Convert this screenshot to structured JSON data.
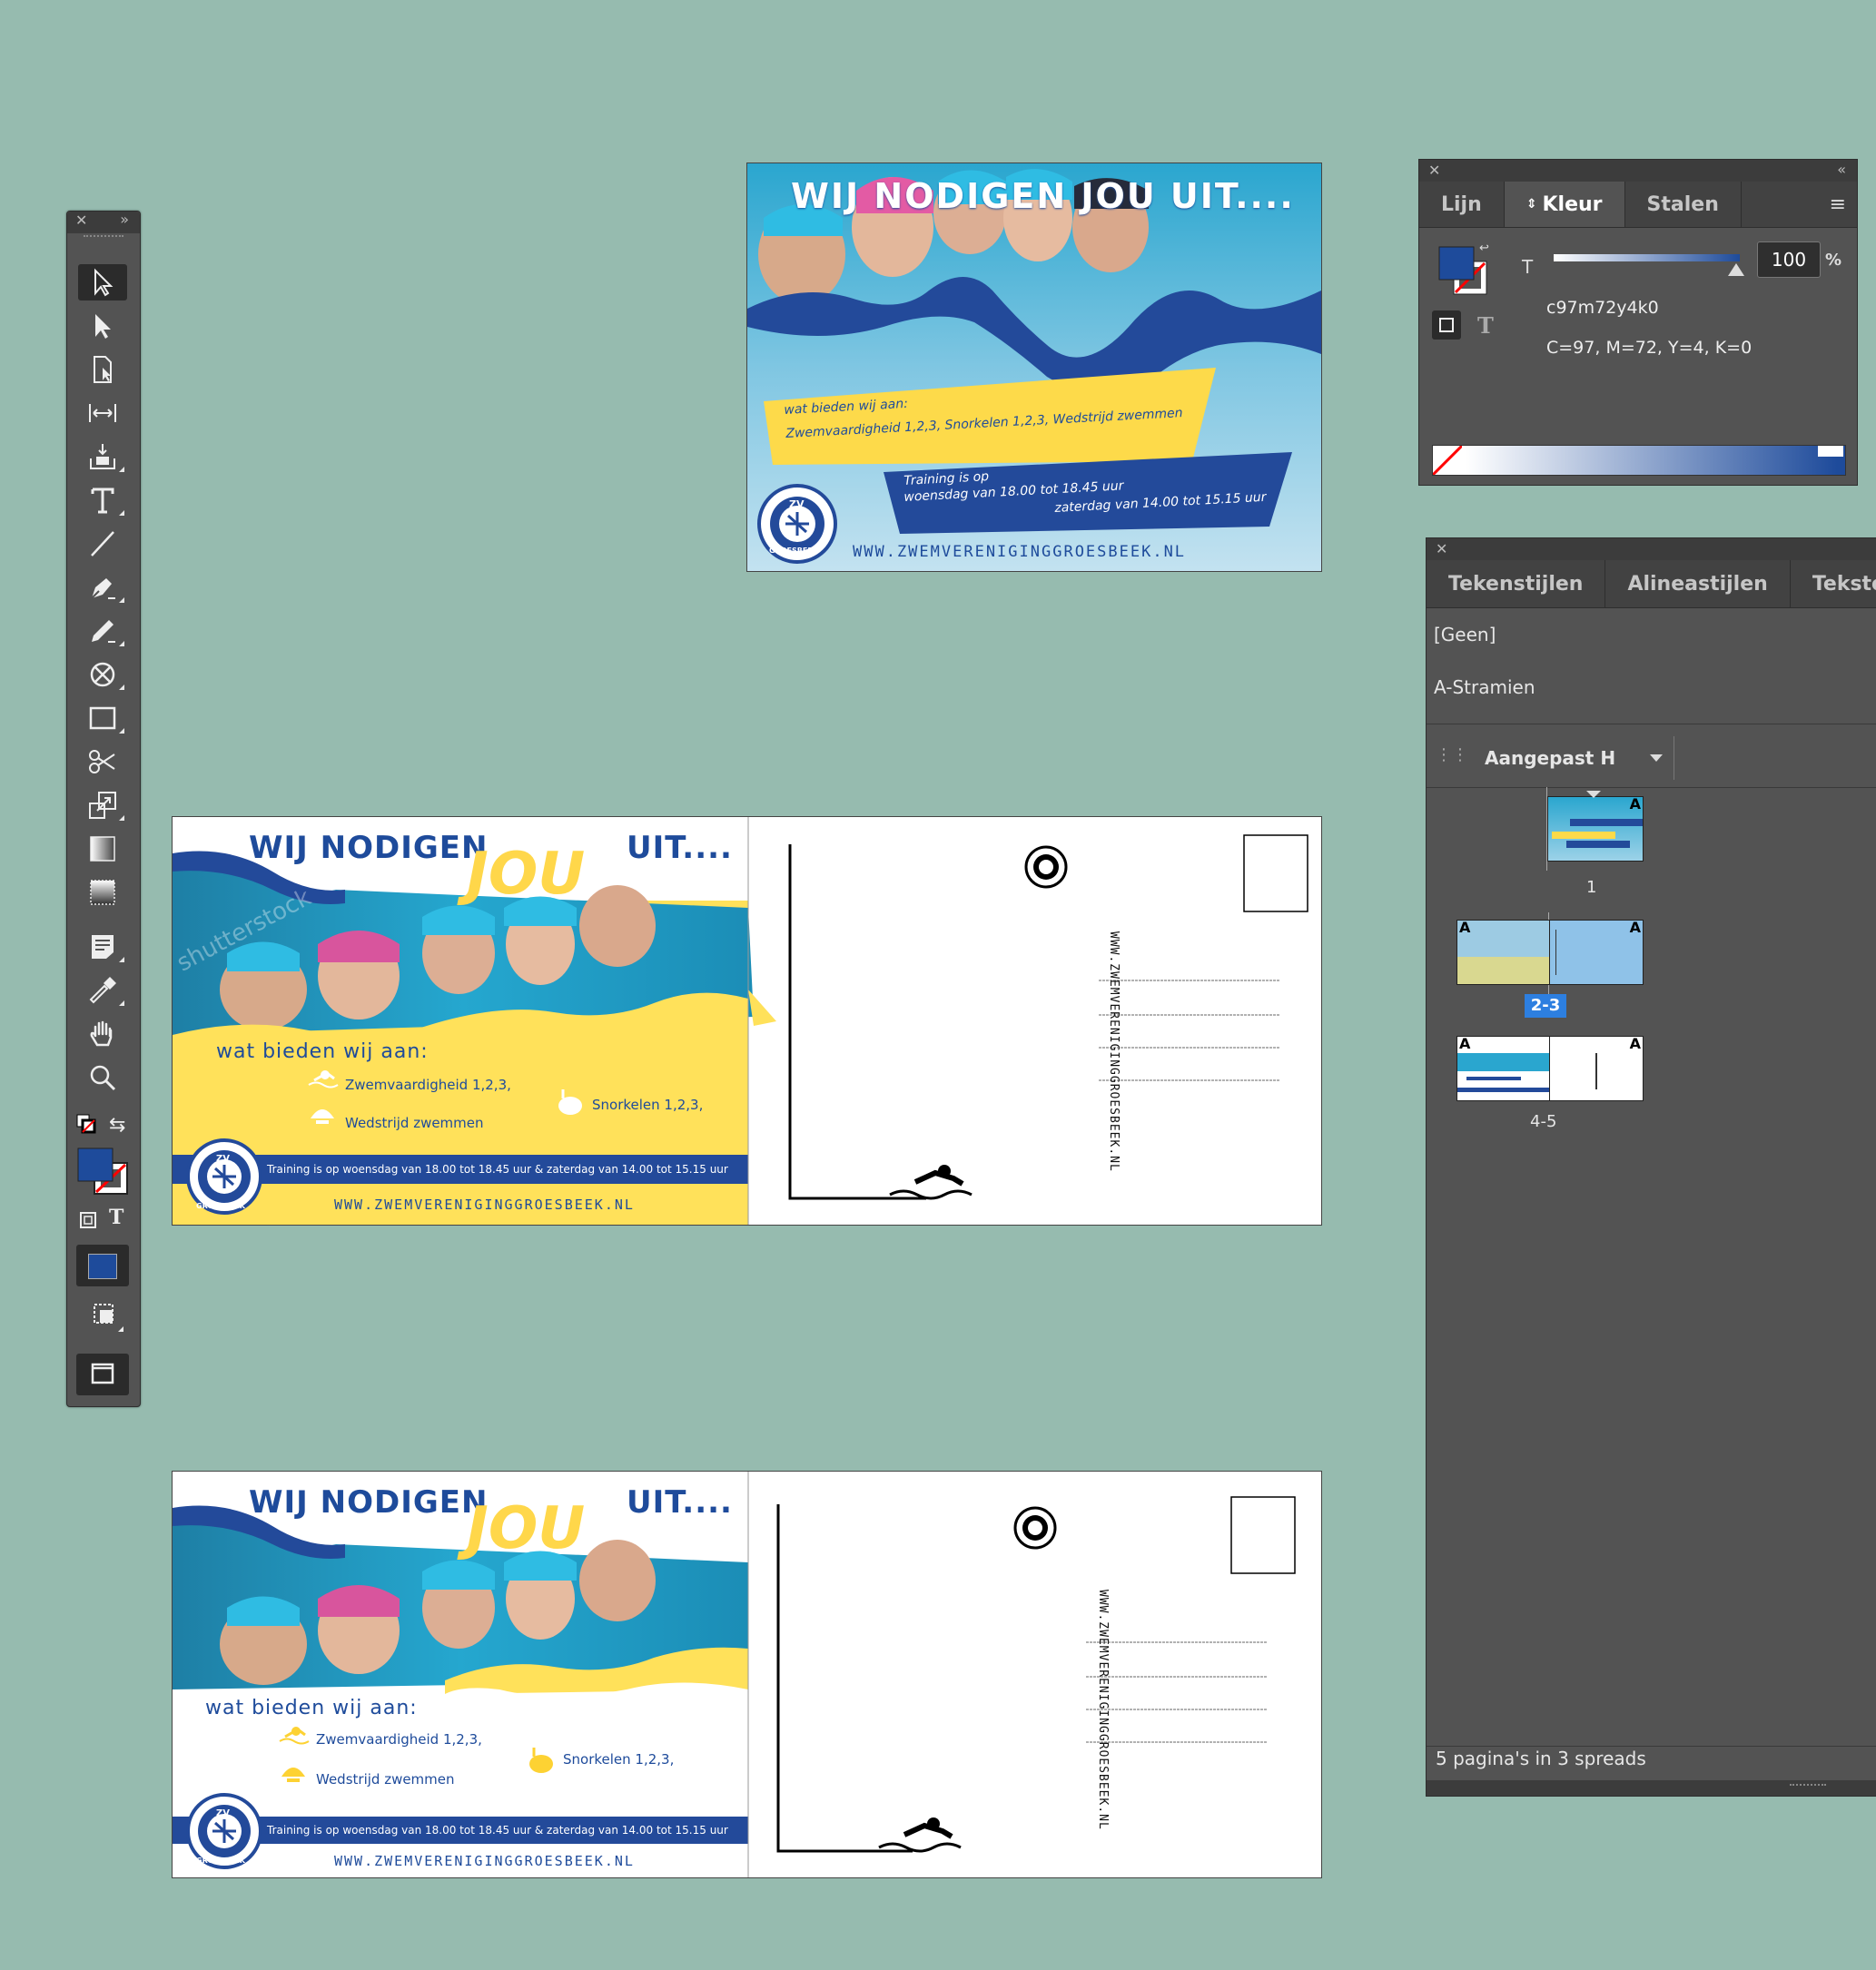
{
  "tools_panel": {
    "close_icon": "✕",
    "collapse_icon": "»",
    "tools": [
      "selection-tool",
      "direct-selection-tool",
      "page-tool",
      "gap-tool",
      "content-collector-tool",
      "type-tool",
      "line-tool",
      "pen-tool",
      "pencil-tool",
      "rectangle-frame-tool",
      "rectangle-tool",
      "scissors-tool",
      "free-transform-tool",
      "gradient-swatch-tool",
      "gradient-feather-tool",
      "note-tool",
      "eyedropper-tool",
      "hand-tool",
      "zoom-tool"
    ],
    "fill_color": "#1E4B9B",
    "formatting_text_label": "T"
  },
  "document": {
    "page1": {
      "title": "WIJ NODIGEN JOU UIT....",
      "offer_heading": "wat bieden wij aan:",
      "offer_line": "Zwemvaardigheid 1,2,3, Snorkelen 1,2,3, Wedstrijd zwemmen",
      "training_line1": "Training is op",
      "training_line2": "woensdag van 18.00 tot 18.45 uur",
      "training_line3": "zaterdag van 14.00 tot 15.15 uur",
      "url": "WWW.ZWEMVERENIGINGGROESBEEK.NL",
      "logo_top": "ZV",
      "logo_bottom": "GROESBEEK"
    },
    "spread": {
      "title_left": "WIJ NODIGEN",
      "title_jou": "JOU",
      "title_right": "UIT....",
      "offer_heading": "wat bieden wij aan:",
      "item1": "Zwemvaardigheid 1,2,3,",
      "item2": "Wedstrijd zwemmen",
      "item3": "Snorkelen 1,2,3,",
      "training": "Training is op woensdag van 18.00 tot 18.45 uur & zaterdag van 14.00 tot 15.15 uur",
      "url": "WWW.ZWEMVERENIGINGGROESBEEK.NL",
      "vertical_url": "WWW.ZWEMVERENIGINGGROESBEEK.NL",
      "logo_top": "ZV",
      "logo_bottom": "GROESBEEK",
      "watermark": "shutterstock"
    }
  },
  "color_panel": {
    "tabs": [
      "Lijn",
      "Kleur",
      "Stalen"
    ],
    "active_tab": "Kleur",
    "tint_label": "T",
    "tint_value": "100",
    "percent": "%",
    "swatch_name": "c97m72y4k0",
    "cmyk": "C=97, M=72, Y=4, K=0",
    "color": "#1E4B9B"
  },
  "pages_panel": {
    "tabs": [
      "Tekenstijlen",
      "Alineastijlen",
      "Tekstom"
    ],
    "items": [
      "[Geen]",
      "A-Stramien"
    ],
    "dropdown": "Aangepast H",
    "page_labels": [
      "1",
      "2-3",
      "4-5"
    ],
    "master_marker": "A",
    "footer": "5 pagina's in 3 spreads"
  }
}
